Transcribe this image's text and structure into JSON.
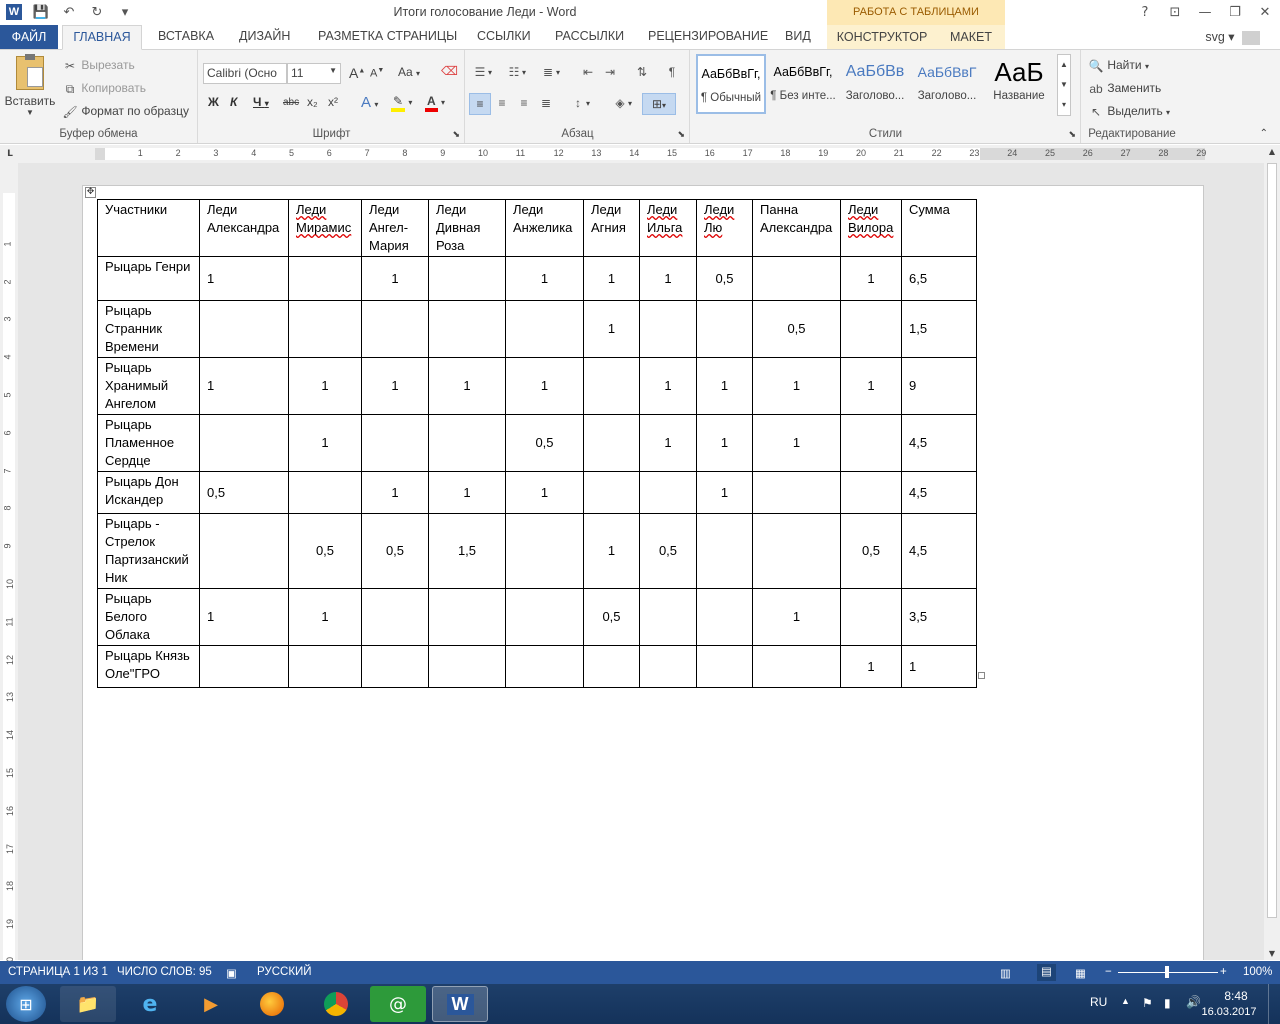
{
  "window": {
    "title": "Итоги голосование Леди - Word",
    "context_header": "РАБОТА С ТАБЛИЦАМИ",
    "controls": {
      "help": "?",
      "restore_ribbon": "⊡",
      "minimize": "—",
      "restore": "❐",
      "close": "✕"
    }
  },
  "tabs": {
    "file": "ФАЙЛ",
    "home": "ГЛАВНАЯ",
    "insert": "ВСТАВКА",
    "design": "ДИЗАЙН",
    "layout": "РАЗМЕТКА СТРАНИЦЫ",
    "references": "ССЫЛКИ",
    "mailings": "РАССЫЛКИ",
    "review": "РЕЦЕНЗИРОВАНИЕ",
    "view": "ВИД",
    "constructor": "КОНСТРУКТОР",
    "table_layout": "МАКЕТ",
    "user": "svg"
  },
  "ribbon": {
    "clipboard": {
      "paste": "Вставить",
      "cut": "Вырезать",
      "copy": "Копировать",
      "format_painter": "Формат по образцу",
      "label": "Буфер обмена"
    },
    "font": {
      "name": "Calibri (Осно",
      "size": "11",
      "label": "Шрифт",
      "bold": "Ж",
      "italic": "К",
      "underline": "Ч",
      "strike": "abc",
      "sub": "x₂",
      "sup": "x²",
      "case": "Aa",
      "grow": "A",
      "shrink": "A"
    },
    "paragraph": {
      "label": "Абзац"
    },
    "styles": {
      "label": "Стили",
      "items": [
        {
          "sample": "АаБбВвГг,",
          "name": "¶ Обычный"
        },
        {
          "sample": "АаБбВвГг,",
          "name": "¶ Без инте..."
        },
        {
          "sample": "АаБбВв",
          "name": "Заголово..."
        },
        {
          "sample": "АаБбВвГ",
          "name": "Заголово..."
        },
        {
          "sample": "АаБ",
          "name": "Название"
        }
      ]
    },
    "editing": {
      "find": "Найти",
      "replace": "Заменить",
      "select": "Выделить",
      "label": "Редактирование"
    }
  },
  "table": {
    "header": [
      "Участники",
      "Леди Александра",
      "Леди Мирамис",
      "Леди Ангел-Мария",
      "Леди Дивная Роза",
      "Леди Анжелика",
      "Леди Агния",
      "Леди Ильга",
      "Леди Лю",
      "Панна Александра",
      "Леди Вилора",
      "Сумма"
    ],
    "rows": [
      [
        "Рыцарь Генри",
        "1",
        "",
        "1",
        "",
        "1",
        "1",
        "1",
        "0,5",
        "",
        "1",
        "6,5"
      ],
      [
        "Рыцарь Странник Времени",
        "",
        "",
        "",
        "",
        "",
        "1",
        "",
        "",
        "0,5",
        "",
        "1,5"
      ],
      [
        "Рыцарь Хранимый Ангелом",
        "1",
        "1",
        "1",
        "1",
        "1",
        "",
        "1",
        "1",
        "1",
        "1",
        "9"
      ],
      [
        "Рыцарь Пламенное Сердце",
        "",
        "1",
        "",
        "",
        "0,5",
        "",
        "1",
        "1",
        "1",
        "",
        "4,5"
      ],
      [
        "Рыцарь Дон Искандер",
        "0,5",
        "",
        "1",
        "1",
        "1",
        "",
        "",
        "1",
        "",
        "",
        "4,5"
      ],
      [
        "Рыцарь - Стрелок Партизанский Ник",
        "",
        "0,5",
        "0,5",
        "1,5",
        "",
        "1",
        "0,5",
        "",
        "",
        "0,5",
        "4,5"
      ],
      [
        "Рыцарь Белого Облака",
        "1",
        "1",
        "",
        "",
        "",
        "0,5",
        "",
        "",
        "1",
        "",
        "3,5"
      ],
      [
        "Рыцарь Князь Оле\"ГРО",
        "",
        "",
        "",
        "",
        "",
        "",
        "",
        "",
        "",
        "1",
        "1"
      ]
    ]
  },
  "status": {
    "page": "СТРАНИЦА 1 ИЗ 1",
    "words": "ЧИСЛО СЛОВ: 95",
    "lang": "РУССКИЙ",
    "zoom": "100%"
  },
  "taskbar": {
    "lang": "RU",
    "time": "8:48",
    "date": "16.03.2017"
  },
  "colors": {
    "accent": "#2b579a",
    "context": "#fde8b4"
  }
}
